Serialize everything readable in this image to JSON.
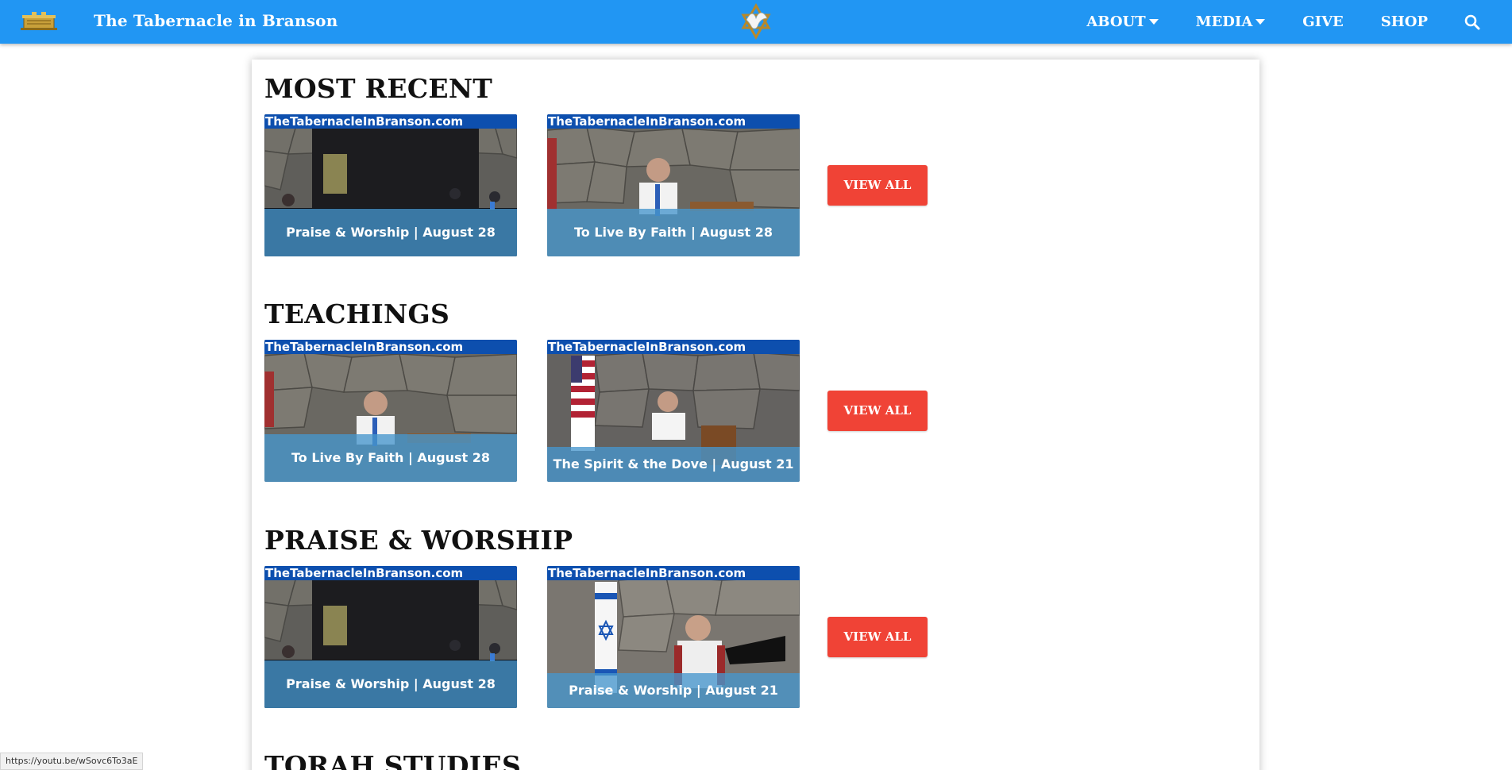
{
  "nav": {
    "site_title": "The Tabernacle in Branson",
    "menu": [
      {
        "label": "ABOUT",
        "has_dropdown": true
      },
      {
        "label": "MEDIA",
        "has_dropdown": true
      },
      {
        "label": "GIVE",
        "has_dropdown": false
      },
      {
        "label": "SHOP",
        "has_dropdown": false
      }
    ],
    "logo_icon": "ark-of-covenant-icon",
    "emblem_icon": "dove-star-emblem-icon",
    "search_icon": "search-icon"
  },
  "colors": {
    "navbar": "#2196f3",
    "button": "#f04336",
    "banner": "#0d4fae",
    "caption_overlay": "#4696cd"
  },
  "sections": [
    {
      "title": "MOST RECENT",
      "videos": [
        {
          "banner": "TheTabernacleInBranson.com",
          "caption": "Praise & Worship | August 28",
          "scene": "band-stage"
        },
        {
          "banner": "TheTabernacleInBranson.com",
          "caption": "To Live By Faith | August 28",
          "scene": "speaker-podium"
        }
      ],
      "button": "VIEW ALL"
    },
    {
      "title": "TEACHINGS",
      "videos": [
        {
          "banner": "TheTabernacleInBranson.com",
          "caption": "To Live By Faith | August 28",
          "scene": "speaker-podium"
        },
        {
          "banner": "TheTabernacleInBranson.com",
          "caption": "The Spirit & the Dove | August 21",
          "scene": "speaker-flag"
        }
      ],
      "button": "VIEW ALL"
    },
    {
      "title": "PRAISE & WORSHIP",
      "videos": [
        {
          "banner": "TheTabernacleInBranson.com",
          "caption": "Praise & Worship | August 28",
          "scene": "band-stage"
        },
        {
          "banner": "TheTabernacleInBranson.com",
          "caption": "Praise & Worship | August 21",
          "scene": "singer-israel-flag"
        }
      ],
      "button": "VIEW ALL"
    },
    {
      "title": "TORAH STUDIES",
      "videos": [],
      "button": ""
    }
  ],
  "status_bar": {
    "url": "https://youtu.be/wSovc6To3aE"
  }
}
